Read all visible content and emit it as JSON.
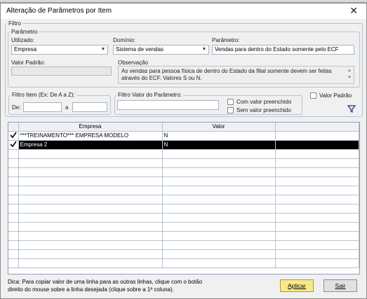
{
  "window": {
    "title": "Alteração de Parâmetros por Item",
    "close_glyph": "✕"
  },
  "filtro": {
    "legend": "Filtro",
    "parametro_group": {
      "legend": "Parâmetro",
      "utilizado": {
        "label": "Utilizado:",
        "value": "Empresa"
      },
      "dominio": {
        "label": "Domínio:",
        "value": "Sistema de vendas"
      },
      "parametro": {
        "label": "Parâmetro:",
        "value": "Vendas para dentro do Estado somente pelo ECF"
      },
      "valor_padrao": {
        "label": "Valor Padrão:",
        "value": ""
      },
      "observacao": {
        "label": "Observação",
        "text": "As vendas para pessoa física de dentro do Estado da filial somente devem ser feitas através do ECF. Valores S ou N."
      }
    },
    "filtro_item": {
      "legend": "Filtro Item (Ex: De A a Z):",
      "de_label": "De:",
      "de_value": "",
      "a_label": "a",
      "a_value": ""
    },
    "filtro_valor": {
      "legend": "Filtro Valor do Parâmetro:",
      "value": "",
      "com_valor": "Com valor preenchido",
      "sem_valor": "Sem valor preenchido"
    },
    "valor_padrao_check": "Valor Padrão",
    "filter_icon": "funnel-icon"
  },
  "grid": {
    "columns": [
      "Empresa",
      "Valor"
    ],
    "rows": [
      {
        "checked": true,
        "empresa": "***TREINAMENTO*** EMPRESA MODELO",
        "valor": "N",
        "active": false
      },
      {
        "checked": true,
        "empresa": "Empresa 2",
        "valor": "N",
        "active": true
      }
    ],
    "empty_rows": 13
  },
  "footer": {
    "hint_line1": "Dica: Para copiar valor de uma linha para as outras linhas, clique com o botão",
    "hint_line2": "direito do mouse sobre a linha desejada (clique sobre a 1ª coluna).",
    "apply_label": "Aplicar",
    "exit_label": "Sair"
  }
}
